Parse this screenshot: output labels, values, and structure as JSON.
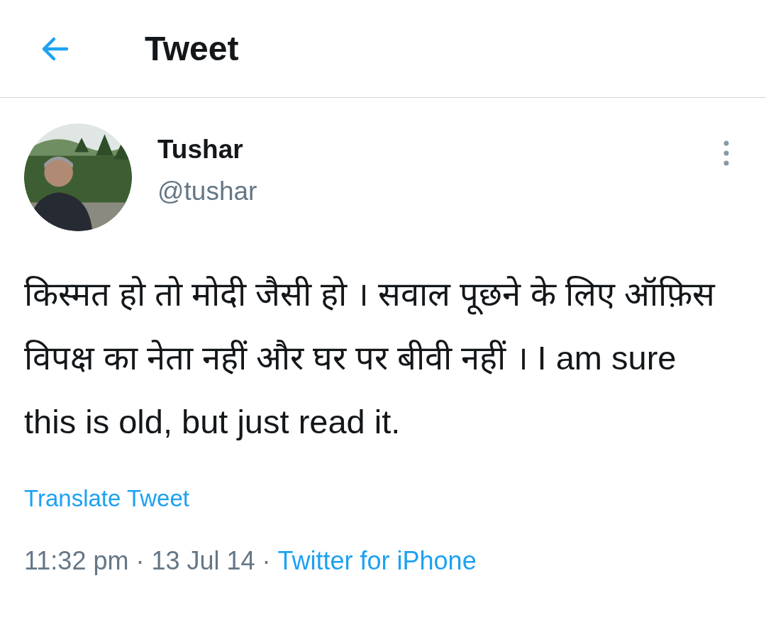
{
  "header": {
    "title": "Tweet"
  },
  "tweet": {
    "author": {
      "name": "Tushar",
      "handle": "@tushar"
    },
    "text": "किस्मत हो तो मोदी जैसी हो । सवाल पूछने के लिए ऑफ़िस विपक्ष का नेता नहीं और घर पर बीवी नहीं । I am sure this is old, but just read it.",
    "translate_link": "Translate Tweet",
    "timestamp": "11:32 pm · 13 Jul 14 ·",
    "source": "Twitter for iPhone"
  }
}
